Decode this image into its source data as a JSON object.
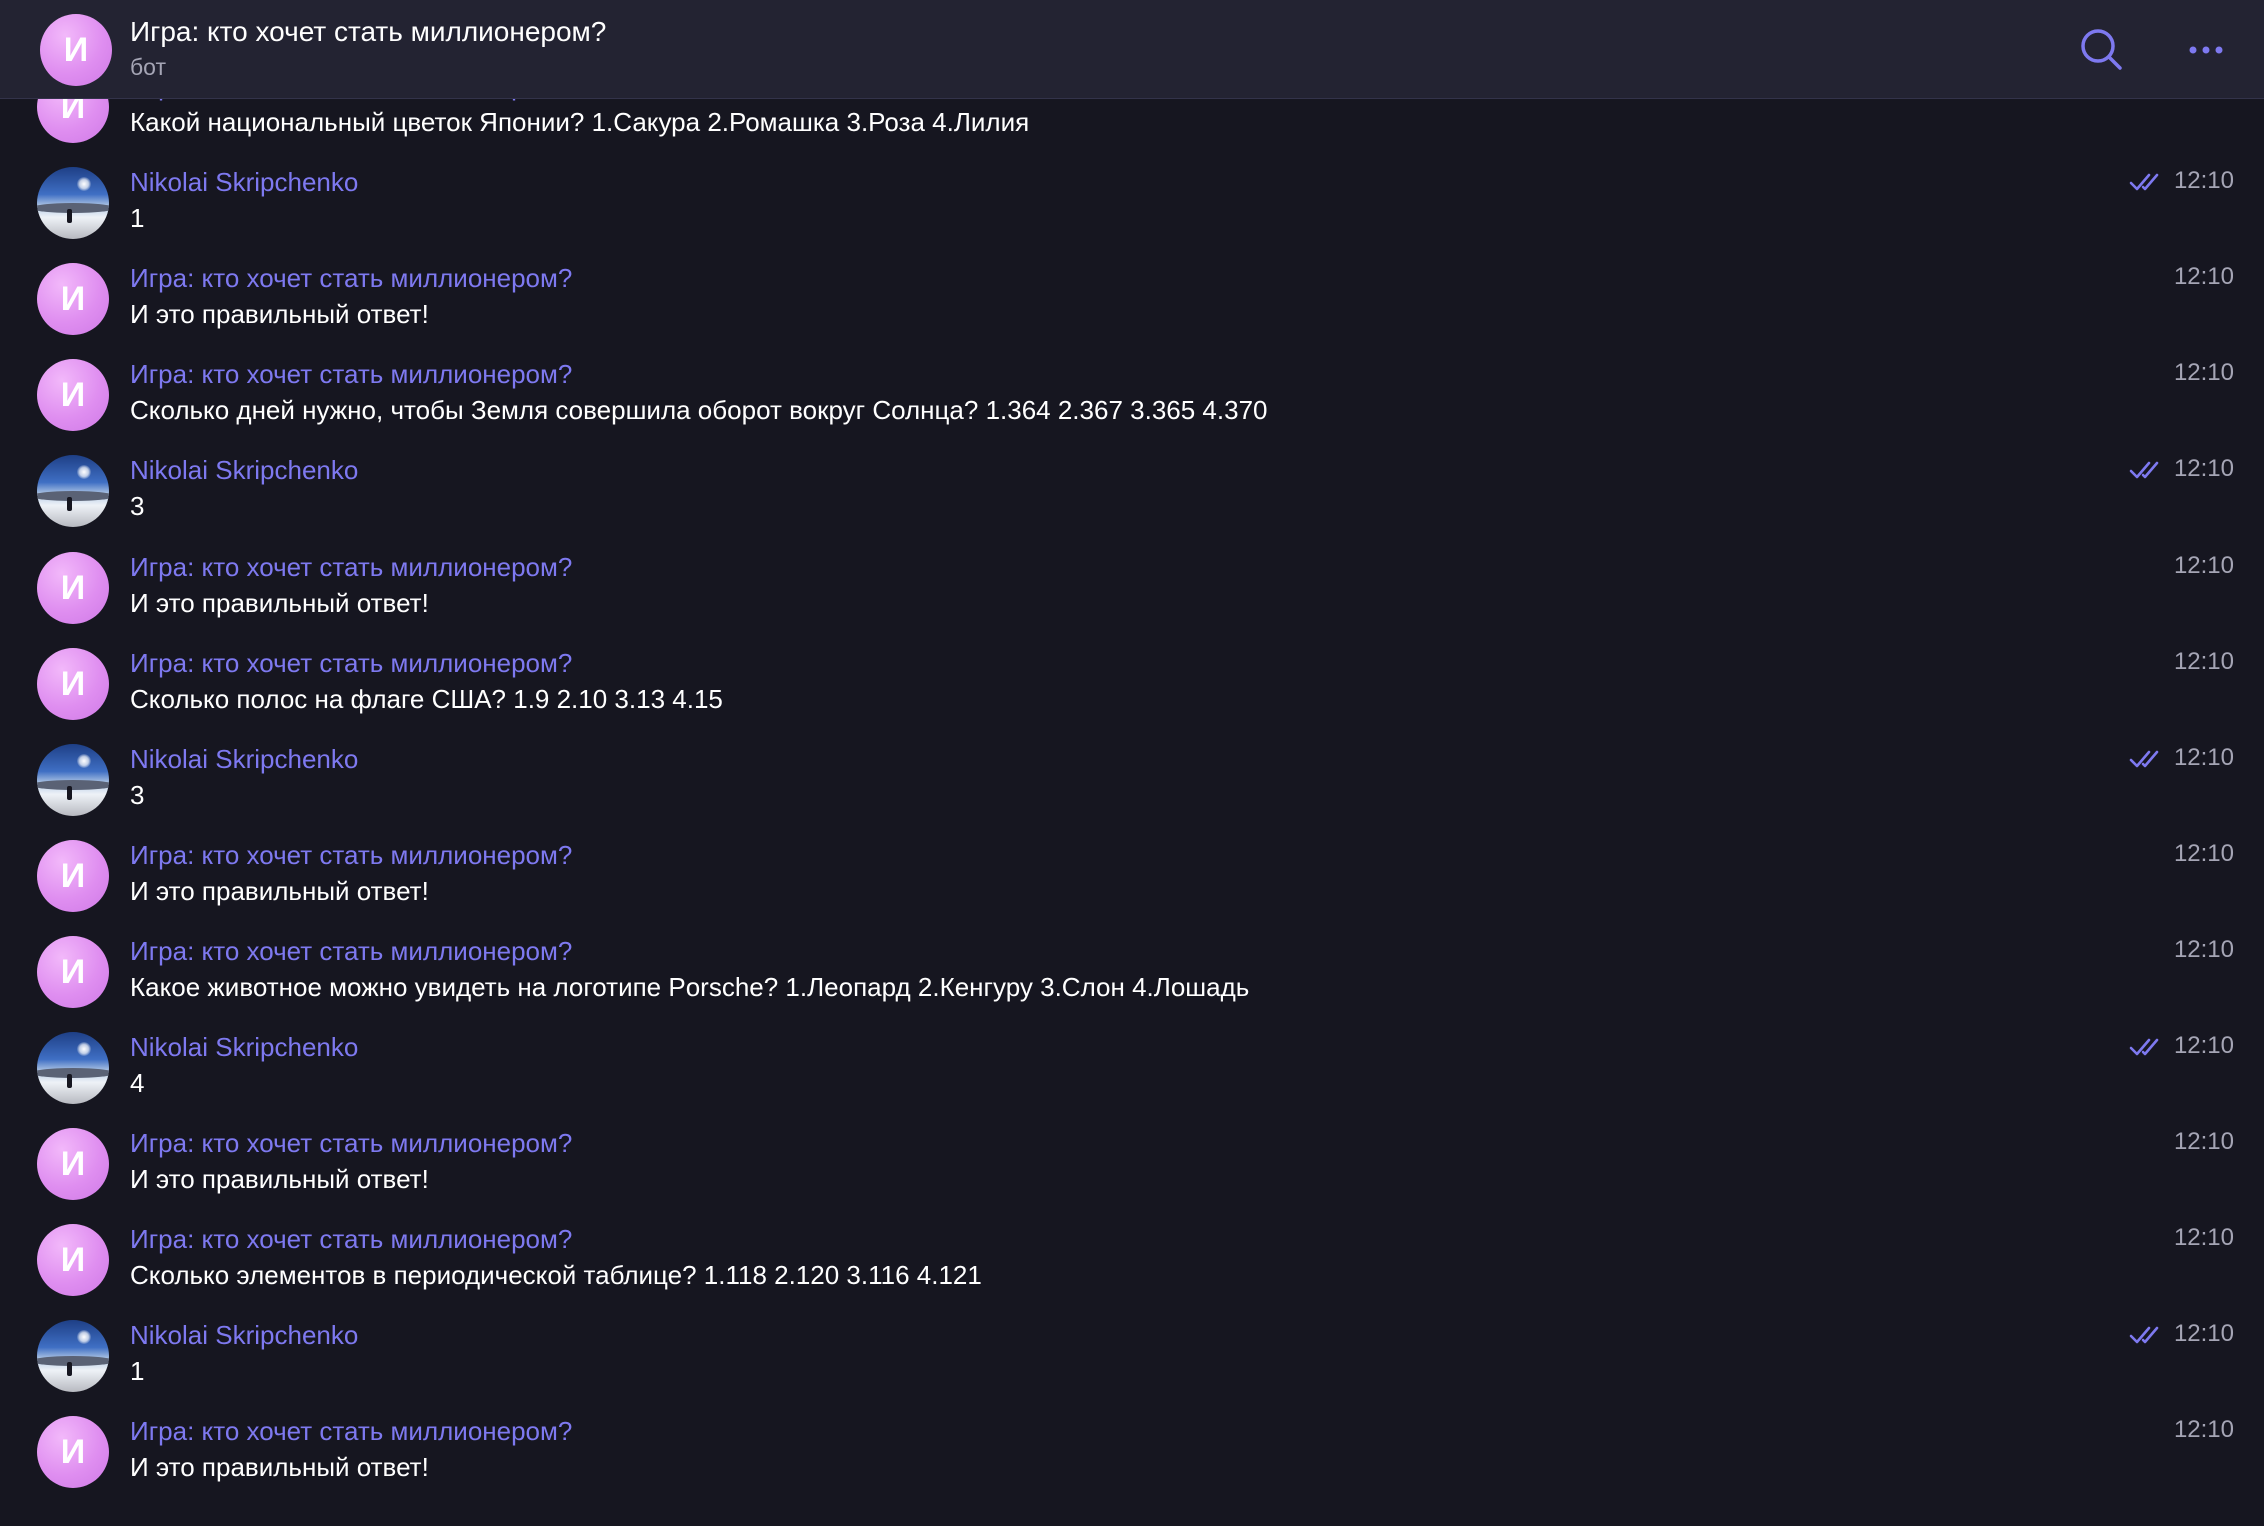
{
  "header": {
    "avatar_letter": "И",
    "title": "Игра: кто хочет стать миллионером?",
    "subtitle": "бот",
    "search_icon": "search-icon",
    "more_icon": "more-dots-icon"
  },
  "colors": {
    "background": "#161620",
    "header_background": "#232332",
    "sender_name": "#7e79f0",
    "time": "#a5a5b5",
    "bot_avatar": "#df8ef0",
    "read_checks": "#7e79f0"
  },
  "messages": [
    {
      "sender": "Игра: кто хочет стать миллионером?",
      "text": "Какой национальный цветок Японии? 1.Сакура 2.Ромашка 3.Роза 4.Лилия",
      "time": "",
      "from_bot": true
    },
    {
      "sender": "Nikolai Skripchenko",
      "text": "1",
      "time": "12:10",
      "from_bot": false,
      "read": true
    },
    {
      "sender": "Игра: кто хочет стать миллионером?",
      "text": "И это правильный ответ!",
      "time": "12:10",
      "from_bot": true
    },
    {
      "sender": "Игра: кто хочет стать миллионером?",
      "text": "Сколько дней нужно, чтобы Земля совершила оборот вокруг Солнца? 1.364 2.367 3.365 4.370",
      "time": "12:10",
      "from_bot": true
    },
    {
      "sender": "Nikolai Skripchenko",
      "text": "3",
      "time": "12:10",
      "from_bot": false,
      "read": true
    },
    {
      "sender": "Игра: кто хочет стать миллионером?",
      "text": "И это правильный ответ!",
      "time": "12:10",
      "from_bot": true
    },
    {
      "sender": "Игра: кто хочет стать миллионером?",
      "text": "Сколько полос на флаге США? 1.9 2.10 3.13 4.15",
      "time": "12:10",
      "from_bot": true
    },
    {
      "sender": "Nikolai Skripchenko",
      "text": "3",
      "time": "12:10",
      "from_bot": false,
      "read": true
    },
    {
      "sender": "Игра: кто хочет стать миллионером?",
      "text": "И это правильный ответ!",
      "time": "12:10",
      "from_bot": true
    },
    {
      "sender": "Игра: кто хочет стать миллионером?",
      "text": "Какое животное можно увидеть на логотипе Porsche? 1.Леопард 2.Кенгуру 3.Слон 4.Лошадь",
      "time": "12:10",
      "from_bot": true
    },
    {
      "sender": "Nikolai Skripchenko",
      "text": "4",
      "time": "12:10",
      "from_bot": false,
      "read": true
    },
    {
      "sender": "Игра: кто хочет стать миллионером?",
      "text": "И это правильный ответ!",
      "time": "12:10",
      "from_bot": true
    },
    {
      "sender": "Игра: кто хочет стать миллионером?",
      "text": "Сколько элементов в периодической таблице? 1.118 2.120 3.116 4.121",
      "time": "12:10",
      "from_bot": true
    },
    {
      "sender": "Nikolai Skripchenko",
      "text": "1",
      "time": "12:10",
      "from_bot": false,
      "read": true
    },
    {
      "sender": "Игра: кто хочет стать миллионером?",
      "text": "И это правильный ответ!",
      "time": "12:10",
      "from_bot": true
    }
  ]
}
